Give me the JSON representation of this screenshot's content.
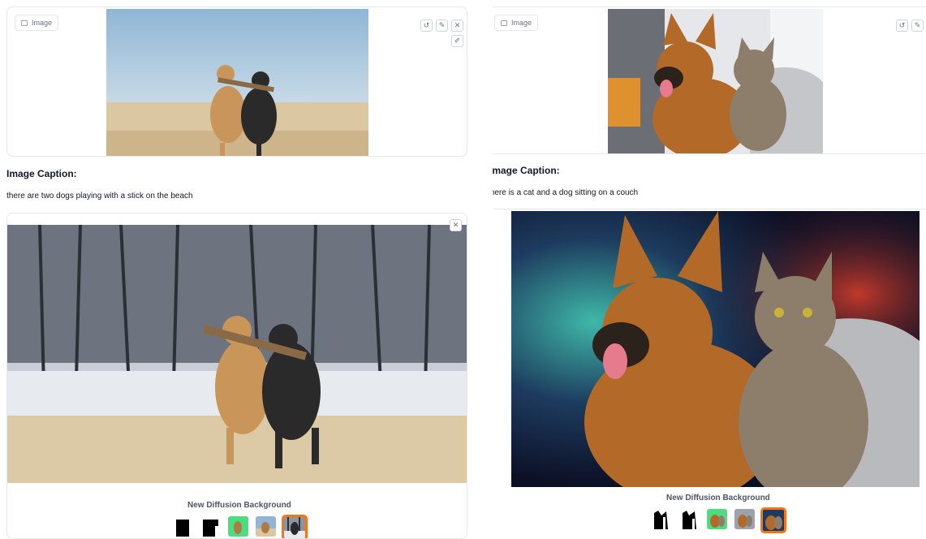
{
  "left": {
    "input_label": "Image",
    "tools": {
      "undo": "↺",
      "edit": "✎",
      "close": "✕",
      "brush": "✐"
    },
    "caption_title": "Image Caption:",
    "caption_text": "there are two dogs playing with a stick on the beach",
    "output_close": "✕",
    "gallery_label": "New Diffusion Background",
    "thumbnails": [
      {
        "name": "thumb-mask-1"
      },
      {
        "name": "thumb-mask-2"
      },
      {
        "name": "thumb-green"
      },
      {
        "name": "thumb-beach"
      },
      {
        "name": "thumb-snow",
        "selected": true
      }
    ]
  },
  "right": {
    "input_label": "Image",
    "tools": {
      "undo": "↺",
      "edit": "✎"
    },
    "caption_title": "Image Caption:",
    "caption_text": "there is a cat and a dog sitting on a couch",
    "gallery_label": "New Diffusion Background",
    "thumbnails": [
      {
        "name": "thumb-mask-1"
      },
      {
        "name": "thumb-mask-2"
      },
      {
        "name": "thumb-green"
      },
      {
        "name": "thumb-couch"
      },
      {
        "name": "thumb-space",
        "selected": true
      }
    ]
  },
  "colors": {
    "accent": "#f97316",
    "border": "#e5e7eb"
  }
}
